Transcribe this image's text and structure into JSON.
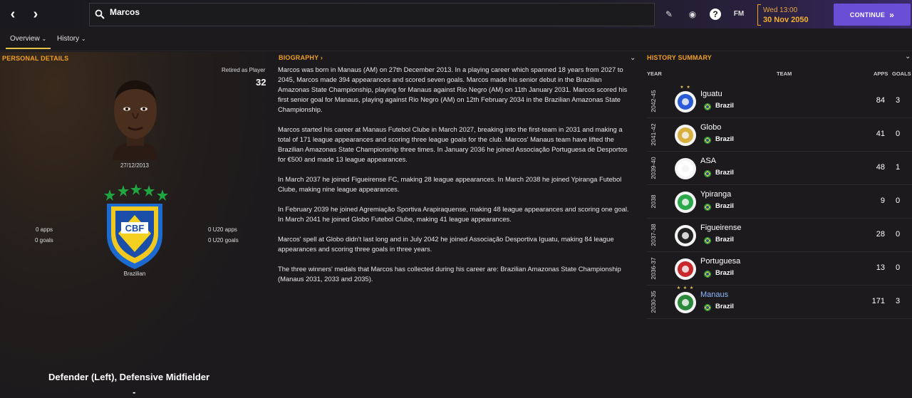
{
  "search": {
    "value": "Marcos"
  },
  "date": {
    "day_time": "Wed 13:00",
    "date": "30 Nov 2050"
  },
  "continue_label": "CONTINUE",
  "fm_label": "FM",
  "tabs": [
    {
      "label": "Overview"
    },
    {
      "label": "History"
    }
  ],
  "personal": {
    "title": "PERSONAL DETAILS",
    "retired_label": "Retired as Player",
    "age": "32",
    "dob": "27/12/2013",
    "federation": "CBF",
    "nationality": "Brazilian",
    "apps": "0 apps",
    "goals": "0 goals",
    "u20_apps": "0 U20 apps",
    "u20_goals": "0 U20 goals",
    "position": "Defender (Left), Defensive Midfielder",
    "dash": "-"
  },
  "bio": {
    "title": "BIOGRAPHY",
    "paragraphs": [
      "Marcos was born in Manaus (AM) on 27th December 2013. In a playing career which spanned 18 years from 2027 to 2045, Marcos made 394 appearances and scored seven goals. Marcos made his senior debut in the Brazilian Amazonas State Championship, playing for Manaus against Rio Negro (AM) on 11th January 2031. Marcos scored his first senior goal for Manaus, playing against Rio Negro (AM) on 12th February 2034 in the Brazilian Amazonas State Championship.",
      "Marcos started his career at Manaus Futebol Clube in March 2027, breaking into the first-team in 2031 and making a total of 171 league appearances and scoring three league goals for the club. Marcos' Manaus team have lifted the Brazilian Amazonas State Championship three times. In January 2036 he joined Associação Portuguesa de Desportos for €500 and made 13 league appearances.",
      "In March 2037 he joined Figueirense FC, making 28 league appearances. In March 2038 he joined Ypiranga Futebol Clube, making nine league appearances.",
      "In February 2039 he joined Agremiação Sportiva Arapiraquense, making 48 league appearances and scoring one goal. In March 2041 he joined Globo Futebol Clube, making 41 league appearances.",
      "Marcos' spell at Globo didn't last long and in July 2042 he joined Associação Desportiva Iguatu, making 84 league appearances and scoring three goals in three years.",
      "The three winners' medals that Marcos has collected during his career are: Brazilian Amazonas State Championship (Manaus 2031, 2033 and 2035)."
    ]
  },
  "history": {
    "title": "HISTORY SUMMARY",
    "columns": {
      "year": "YEAR",
      "team": "TEAM",
      "apps": "APPS",
      "goals": "GOALS"
    },
    "rows": [
      {
        "year": "2042-45",
        "team": "Iguatu",
        "country": "Brazil",
        "apps": "84",
        "goals": "3",
        "stars": "★ ★",
        "badge_color": "#2a5ad6"
      },
      {
        "year": "2041-42",
        "team": "Globo",
        "country": "Brazil",
        "apps": "41",
        "goals": "0",
        "stars": "",
        "badge_color": "#d8b040"
      },
      {
        "year": "2039-40",
        "team": "ASA",
        "country": "Brazil",
        "apps": "48",
        "goals": "1",
        "stars": "",
        "badge_color": "#ffffff"
      },
      {
        "year": "2038",
        "team": "Ypiranga",
        "country": "Brazil",
        "apps": "9",
        "goals": "0",
        "stars": "",
        "badge_color": "#2aa84a"
      },
      {
        "year": "2037-38",
        "team": "Figueirense",
        "country": "Brazil",
        "apps": "28",
        "goals": "0",
        "stars": "",
        "badge_color": "#222222"
      },
      {
        "year": "2036-37",
        "team": "Portuguesa",
        "country": "Brazil",
        "apps": "13",
        "goals": "0",
        "stars": "",
        "badge_color": "#c8282a"
      },
      {
        "year": "2030-35",
        "team": "Manaus",
        "country": "Brazil",
        "apps": "171",
        "goals": "3",
        "stars": "★ ★ ★",
        "badge_color": "#2a8a3a"
      }
    ]
  },
  "colors": {
    "accent": "#f0a020",
    "continue": "#6a4fd6",
    "link": "#8fb8ff"
  }
}
